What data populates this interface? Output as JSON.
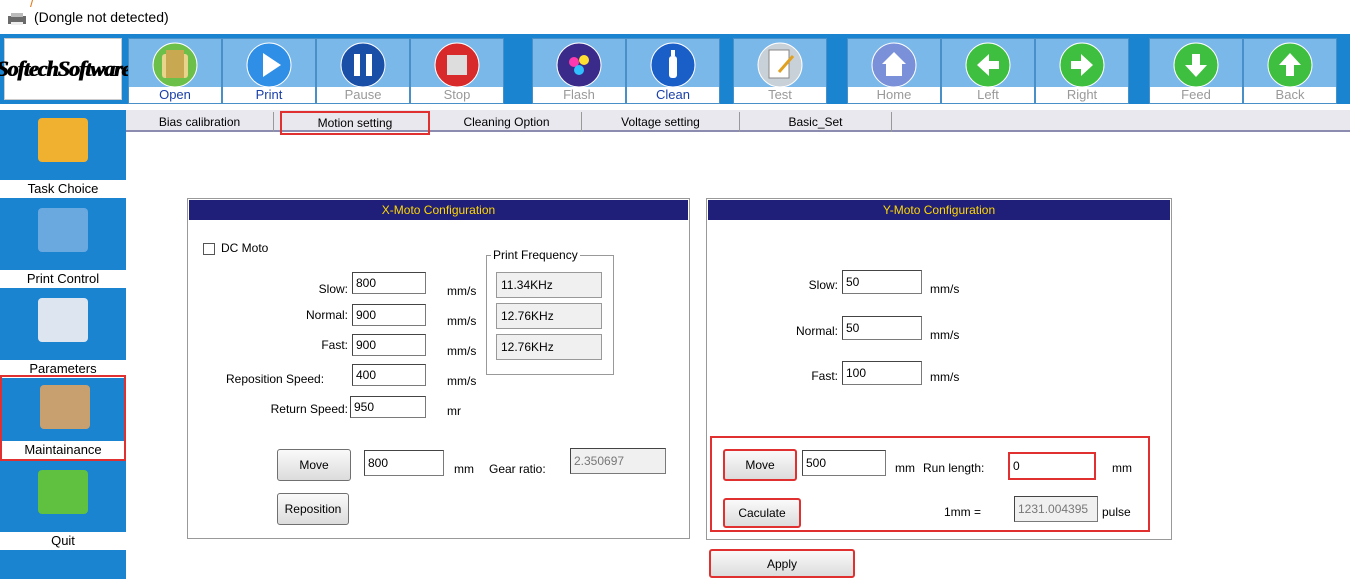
{
  "title": {
    "status": "(Dongle not detected)"
  },
  "logo": "SoftechSoftware",
  "toolbar": [
    {
      "label": "Open",
      "active": true,
      "icon": "folder-icon",
      "color": "#6cc04a"
    },
    {
      "label": "Print",
      "active": true,
      "icon": "play-icon",
      "color": "#2f8ee6"
    },
    {
      "label": "Pause",
      "active": false,
      "icon": "pause-icon",
      "color": "#1a4fa8"
    },
    {
      "label": "Stop",
      "active": false,
      "icon": "stop-icon",
      "color": "#d82a2a"
    },
    {
      "label": "Flash",
      "active": false,
      "icon": "ink-drops-icon",
      "color": "#3a2a8a"
    },
    {
      "label": "Clean",
      "active": true,
      "icon": "bottle-icon",
      "color": "#1a5fc8"
    },
    {
      "label": "Test",
      "active": false,
      "icon": "document-pen-icon",
      "color": "#c8d0d8"
    },
    {
      "label": "Home",
      "active": false,
      "icon": "home-icon",
      "color": "#7a90d8"
    },
    {
      "label": "Left",
      "active": false,
      "icon": "arrow-left-icon",
      "color": "#3fbf3f"
    },
    {
      "label": "Right",
      "active": false,
      "icon": "arrow-right-icon",
      "color": "#3fbf3f"
    },
    {
      "label": "Feed",
      "active": false,
      "icon": "arrow-down-icon",
      "color": "#3fbf3f"
    },
    {
      "label": "Back",
      "active": false,
      "icon": "arrow-up-icon",
      "color": "#3fbf3f"
    }
  ],
  "sidebar": [
    {
      "label": "Task Choice",
      "icon": "folder-icon",
      "color": "#f0b030"
    },
    {
      "label": "Print Control",
      "icon": "disc-icon",
      "color": "#6aa8e0"
    },
    {
      "label": "Parameters",
      "icon": "gear-icon",
      "color": "#dde6f0"
    },
    {
      "label": "Maintainance",
      "icon": "tools-icon",
      "color": "#c8a070",
      "selected": true
    },
    {
      "label": "Quit",
      "icon": "exit-person-icon",
      "color": "#60c040"
    }
  ],
  "tabs": [
    "Bias calibration",
    "Motion setting",
    "Cleaning Option",
    "Voltage setting",
    "Basic_Set"
  ],
  "x_moto": {
    "title": "X-Moto Configuration",
    "dc_moto_label": "DC Moto",
    "dc_moto_checked": false,
    "slow_label": "Slow:",
    "slow": "800",
    "normal_label": "Normal:",
    "normal": "900",
    "fast_label": "Fast:",
    "fast": "900",
    "reposition_label": "Reposition Speed:",
    "reposition": "400",
    "return_label": "Return Speed:",
    "return": "950",
    "unit_mms": "mm/s",
    "unit_mr": "mr",
    "freq_title": "Print Frequency",
    "freq": [
      "11.34KHz",
      "12.76KHz",
      "12.76KHz"
    ],
    "move_button": "Move",
    "move_value": "800",
    "unit_mm": "mm",
    "gear_label": "Gear ratio:",
    "gear_value": "2.350697",
    "reposition_button": "Reposition"
  },
  "y_moto": {
    "title": "Y-Moto Configuration",
    "slow_label": "Slow:",
    "slow": "50",
    "normal_label": "Normal:",
    "normal": "50",
    "fast_label": "Fast:",
    "fast": "100",
    "unit_mms": "mm/s",
    "move_button": "Move",
    "move_value": "500",
    "unit_mm": "mm",
    "run_length_label": "Run length:",
    "run_length": "0",
    "caculate_button": "Caculate",
    "one_mm_label": "1mm =",
    "pulse_value": "1231.004395",
    "pulse_unit": "pulse"
  },
  "apply_button": "Apply"
}
